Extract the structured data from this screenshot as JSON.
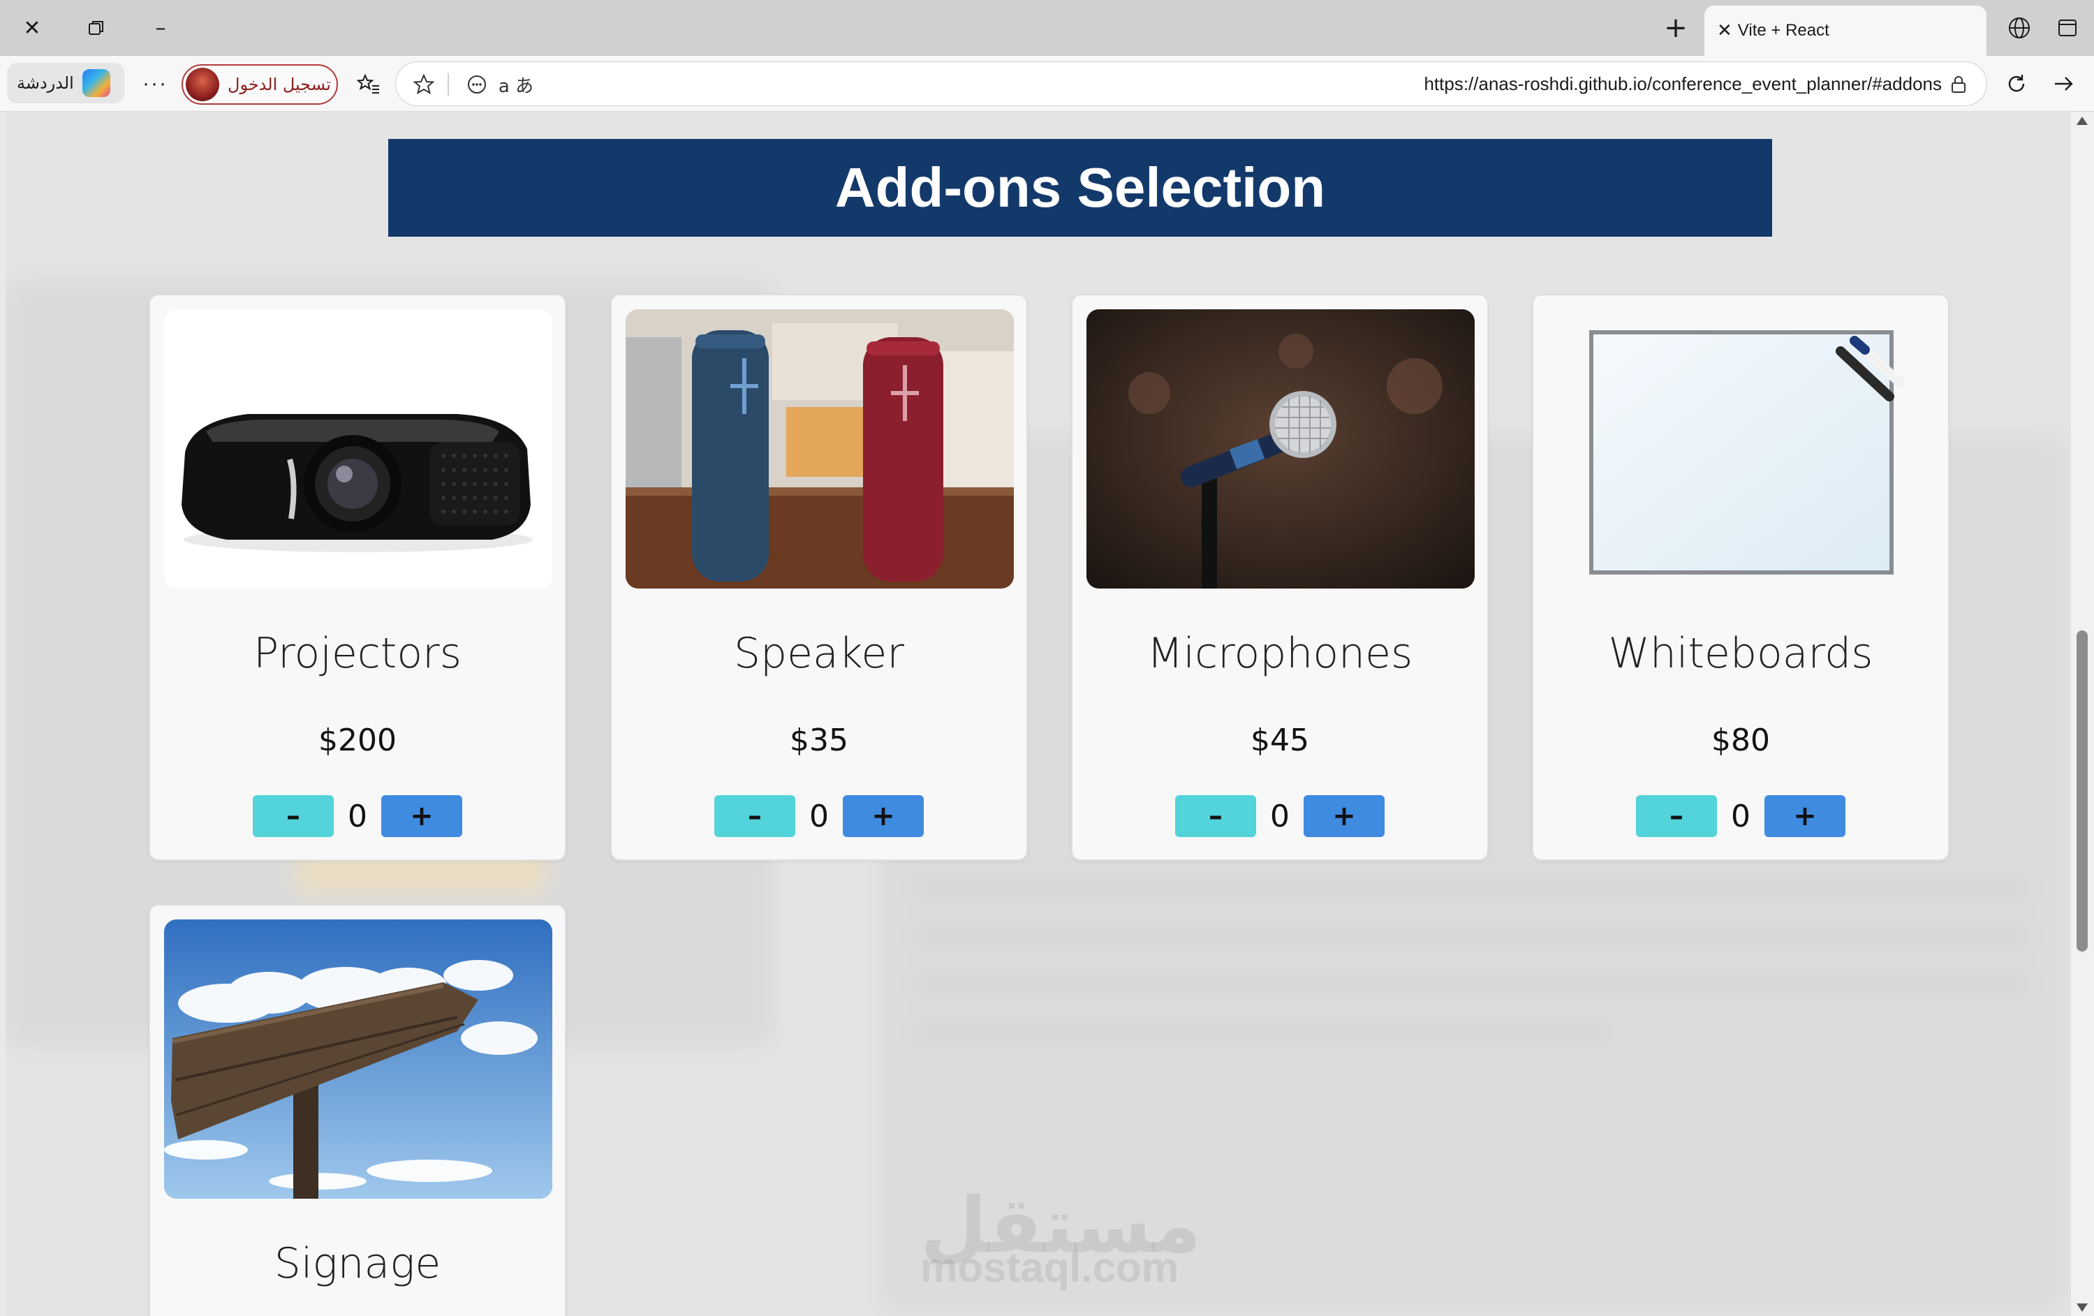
{
  "browser": {
    "tab_title": "Vite + React",
    "url": "https://anas-roshdi.github.io/conference_event_planner/#addons",
    "chat_label": "الدردشة",
    "signin_label": "تسجيل الدخول",
    "more_label": "···"
  },
  "page": {
    "heading": "Add-ons Selection",
    "watermark_ar": "مستقل",
    "watermark_en": "mostaql.com"
  },
  "addons": [
    {
      "name": "Projectors",
      "price": "$200",
      "quantity": "0",
      "image": "projector"
    },
    {
      "name": "Speaker",
      "price": "$35",
      "quantity": "0",
      "image": "speakers"
    },
    {
      "name": "Microphones",
      "price": "$45",
      "quantity": "0",
      "image": "microphone"
    },
    {
      "name": "Whiteboards",
      "price": "$80",
      "quantity": "0",
      "image": "whiteboard"
    },
    {
      "name": "Signage",
      "price": "",
      "quantity": "",
      "image": "signpost"
    }
  ],
  "controls": {
    "decrement": "–",
    "increment": "+"
  },
  "colors": {
    "heading_bg": "#13396b",
    "decrement_bg": "#53d3da",
    "increment_bg": "#3f8be0"
  }
}
